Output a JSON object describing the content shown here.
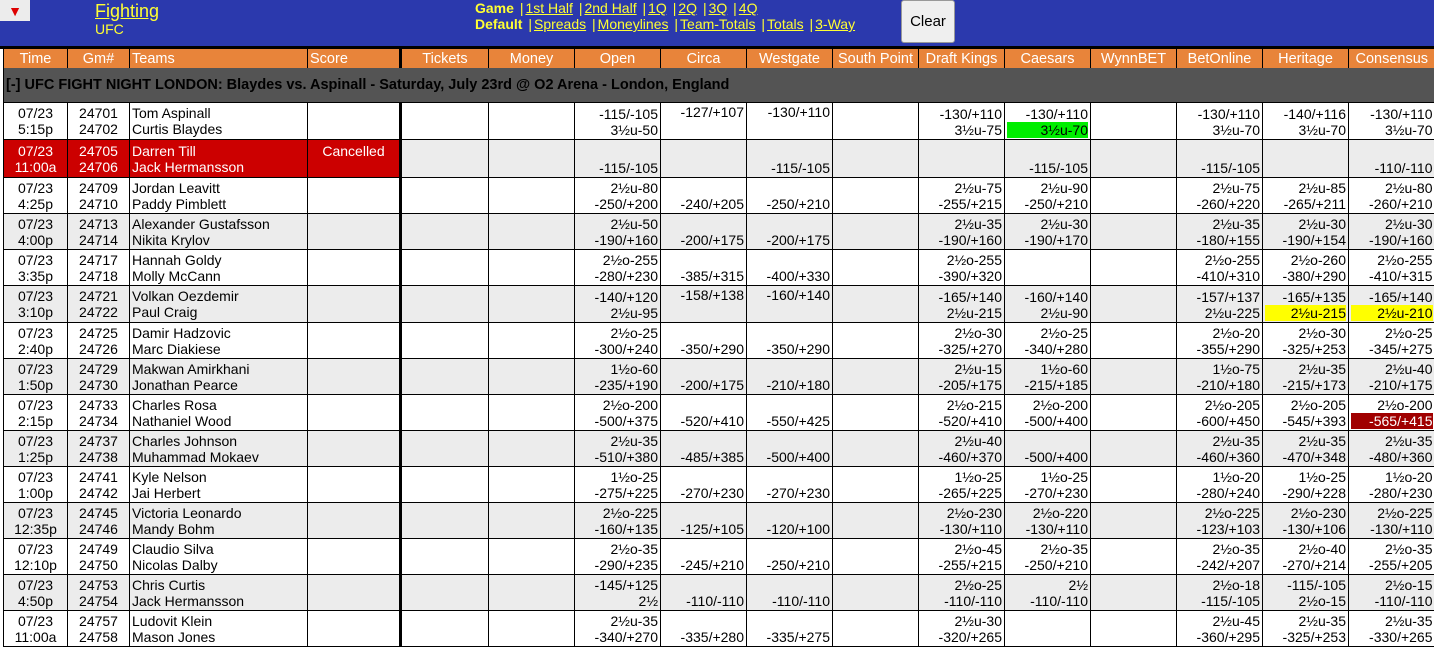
{
  "header": {
    "menu_icon": "▼",
    "sport_link": "Fighting",
    "league": "UFC",
    "periods_label": "Game",
    "periods": [
      "1st Half",
      "2nd Half",
      "1Q",
      "2Q",
      "3Q",
      "4Q"
    ],
    "markets_label": "Default",
    "markets": [
      "Spreads",
      "Moneylines",
      "Team-Totals",
      "Totals",
      "3-Way"
    ],
    "clear_label": "Clear"
  },
  "columns": [
    "Time",
    "Gm#",
    "Teams",
    "Score",
    "Tickets",
    "Money",
    "Open",
    "Circa",
    "Westgate",
    "South Point",
    "Draft Kings",
    "Caesars",
    "WynnBET",
    "BetOnline",
    "Heritage",
    "Consensus"
  ],
  "event_title": "[-]  UFC FIGHT NIGHT LONDON: Blaydes vs. Aspinall - Saturday, July 23rd @ O2 Arena - London, England",
  "highlight_colors": {
    "green": "#00ee00",
    "yellow": "#ffff00",
    "dark_red": "#a00000",
    "cancelled": "#cc0000"
  },
  "games": [
    {
      "date": "07/23",
      "time": "5:15p",
      "gm1": "24701",
      "gm2": "24702",
      "team1": "Tom Aspinall",
      "team2": "Curtis Blaydes",
      "score": "",
      "status": "",
      "open": [
        "-115/-105",
        "3½u-50"
      ],
      "circa": [
        "-127/+107",
        ""
      ],
      "westgate": [
        "-130/+110",
        ""
      ],
      "southpoint": [
        "",
        ""
      ],
      "draftkings": [
        "-130/+110",
        "3½u-75"
      ],
      "caesars": [
        "-130/+110",
        "3½u-70"
      ],
      "wynnbet": [
        "",
        ""
      ],
      "betonline": [
        "-130/+110",
        "3½u-70"
      ],
      "heritage": [
        "-140/+116",
        "3½u-70"
      ],
      "consensus": [
        "-130/+110",
        "3½u-70"
      ],
      "highlights": {
        "caesars.1": "green"
      }
    },
    {
      "date": "07/23",
      "time": "11:00a",
      "gm1": "24705",
      "gm2": "24706",
      "team1": "Darren Till",
      "team2": "Jack Hermansson",
      "score": "Cancelled",
      "status": "cancelled",
      "open": [
        "",
        "-115/-105"
      ],
      "circa": [
        "",
        ""
      ],
      "westgate": [
        "",
        "-115/-105"
      ],
      "southpoint": [
        "",
        ""
      ],
      "draftkings": [
        "",
        ""
      ],
      "caesars": [
        "",
        "-115/-105"
      ],
      "wynnbet": [
        "",
        ""
      ],
      "betonline": [
        "",
        "-115/-105"
      ],
      "heritage": [
        "",
        ""
      ],
      "consensus": [
        "",
        "-110/-110"
      ]
    },
    {
      "date": "07/23",
      "time": "4:25p",
      "gm1": "24709",
      "gm2": "24710",
      "team1": "Jordan Leavitt",
      "team2": "Paddy Pimblett",
      "score": "",
      "status": "",
      "open": [
        "2½u-80",
        "-250/+200"
      ],
      "circa": [
        "",
        "-240/+205"
      ],
      "westgate": [
        "",
        "-250/+210"
      ],
      "southpoint": [
        "",
        ""
      ],
      "draftkings": [
        "2½u-75",
        "-255/+215"
      ],
      "caesars": [
        "2½u-90",
        "-250/+210"
      ],
      "wynnbet": [
        "",
        ""
      ],
      "betonline": [
        "2½u-75",
        "-260/+220"
      ],
      "heritage": [
        "2½u-85",
        "-265/+211"
      ],
      "consensus": [
        "2½u-80",
        "-260/+210"
      ]
    },
    {
      "date": "07/23",
      "time": "4:00p",
      "gm1": "24713",
      "gm2": "24714",
      "team1": "Alexander Gustafsson",
      "team2": "Nikita Krylov",
      "score": "",
      "status": "",
      "open": [
        "2½u-50",
        "-190/+160"
      ],
      "circa": [
        "",
        "-200/+175"
      ],
      "westgate": [
        "",
        "-200/+175"
      ],
      "southpoint": [
        "",
        ""
      ],
      "draftkings": [
        "2½u-35",
        "-190/+160"
      ],
      "caesars": [
        "2½u-30",
        "-190/+170"
      ],
      "wynnbet": [
        "",
        ""
      ],
      "betonline": [
        "2½u-35",
        "-180/+155"
      ],
      "heritage": [
        "2½u-30",
        "-190/+154"
      ],
      "consensus": [
        "2½u-30",
        "-190/+160"
      ]
    },
    {
      "date": "07/23",
      "time": "3:35p",
      "gm1": "24717",
      "gm2": "24718",
      "team1": "Hannah Goldy",
      "team2": "Molly McCann",
      "score": "",
      "status": "",
      "open": [
        "2½o-255",
        "-280/+230"
      ],
      "circa": [
        "",
        "-385/+315"
      ],
      "westgate": [
        "",
        "-400/+330"
      ],
      "southpoint": [
        "",
        ""
      ],
      "draftkings": [
        "2½o-255",
        "-390/+320"
      ],
      "caesars": [
        "",
        ""
      ],
      "wynnbet": [
        "",
        ""
      ],
      "betonline": [
        "2½o-255",
        "-410/+310"
      ],
      "heritage": [
        "2½o-260",
        "-380/+290"
      ],
      "consensus": [
        "2½o-255",
        "-410/+315"
      ]
    },
    {
      "date": "07/23",
      "time": "3:10p",
      "gm1": "24721",
      "gm2": "24722",
      "team1": "Volkan Oezdemir",
      "team2": "Paul Craig",
      "score": "",
      "status": "",
      "open": [
        "-140/+120",
        "2½u-95"
      ],
      "circa": [
        "-158/+138",
        ""
      ],
      "westgate": [
        "-160/+140",
        ""
      ],
      "southpoint": [
        "",
        ""
      ],
      "draftkings": [
        "-165/+140",
        "2½u-215"
      ],
      "caesars": [
        "-160/+140",
        "2½u-90"
      ],
      "wynnbet": [
        "",
        ""
      ],
      "betonline": [
        "-157/+137",
        "2½u-225"
      ],
      "heritage": [
        "-165/+135",
        "2½u-215"
      ],
      "consensus": [
        "-165/+140",
        "2½u-210"
      ],
      "highlights": {
        "heritage.1": "yellow",
        "consensus.1": "yellow"
      }
    },
    {
      "date": "07/23",
      "time": "2:40p",
      "gm1": "24725",
      "gm2": "24726",
      "team1": "Damir Hadzovic",
      "team2": "Marc Diakiese",
      "score": "",
      "status": "",
      "open": [
        "2½o-25",
        "-300/+240"
      ],
      "circa": [
        "",
        "-350/+290"
      ],
      "westgate": [
        "",
        "-350/+290"
      ],
      "southpoint": [
        "",
        ""
      ],
      "draftkings": [
        "2½o-30",
        "-325/+270"
      ],
      "caesars": [
        "2½o-25",
        "-340/+280"
      ],
      "wynnbet": [
        "",
        ""
      ],
      "betonline": [
        "2½o-20",
        "-355/+290"
      ],
      "heritage": [
        "2½o-30",
        "-325/+253"
      ],
      "consensus": [
        "2½o-25",
        "-345/+275"
      ]
    },
    {
      "date": "07/23",
      "time": "1:50p",
      "gm1": "24729",
      "gm2": "24730",
      "team1": "Makwan Amirkhani",
      "team2": "Jonathan Pearce",
      "score": "",
      "status": "",
      "open": [
        "1½o-60",
        "-235/+190"
      ],
      "circa": [
        "",
        "-200/+175"
      ],
      "westgate": [
        "",
        "-210/+180"
      ],
      "southpoint": [
        "",
        ""
      ],
      "draftkings": [
        "2½u-15",
        "-205/+175"
      ],
      "caesars": [
        "1½o-60",
        "-215/+185"
      ],
      "wynnbet": [
        "",
        ""
      ],
      "betonline": [
        "1½o-75",
        "-210/+180"
      ],
      "heritage": [
        "2½u-35",
        "-215/+173"
      ],
      "consensus": [
        "2½u-40",
        "-210/+175"
      ]
    },
    {
      "date": "07/23",
      "time": "2:15p",
      "gm1": "24733",
      "gm2": "24734",
      "team1": "Charles Rosa",
      "team2": "Nathaniel Wood",
      "score": "",
      "status": "",
      "open": [
        "2½o-200",
        "-500/+375"
      ],
      "circa": [
        "",
        "-520/+410"
      ],
      "westgate": [
        "",
        "-550/+425"
      ],
      "southpoint": [
        "",
        ""
      ],
      "draftkings": [
        "2½o-215",
        "-520/+410"
      ],
      "caesars": [
        "2½o-200",
        "-500/+400"
      ],
      "wynnbet": [
        "",
        ""
      ],
      "betonline": [
        "2½o-205",
        "-600/+450"
      ],
      "heritage": [
        "2½o-205",
        "-545/+393"
      ],
      "consensus": [
        "2½o-200",
        "-565/+415"
      ],
      "highlights": {
        "consensus.1": "dark_red"
      }
    },
    {
      "date": "07/23",
      "time": "1:25p",
      "gm1": "24737",
      "gm2": "24738",
      "team1": "Charles Johnson",
      "team2": "Muhammad Mokaev",
      "score": "",
      "status": "",
      "open": [
        "2½u-35",
        "-510/+380"
      ],
      "circa": [
        "",
        "-485/+385"
      ],
      "westgate": [
        "",
        "-500/+400"
      ],
      "southpoint": [
        "",
        ""
      ],
      "draftkings": [
        "2½u-40",
        "-460/+370"
      ],
      "caesars": [
        "",
        "-500/+400"
      ],
      "wynnbet": [
        "",
        ""
      ],
      "betonline": [
        "2½u-35",
        "-460/+360"
      ],
      "heritage": [
        "2½u-35",
        "-470/+348"
      ],
      "consensus": [
        "2½u-35",
        "-480/+360"
      ]
    },
    {
      "date": "07/23",
      "time": "1:00p",
      "gm1": "24741",
      "gm2": "24742",
      "team1": "Kyle Nelson",
      "team2": "Jai Herbert",
      "score": "",
      "status": "",
      "open": [
        "1½o-25",
        "-275/+225"
      ],
      "circa": [
        "",
        "-270/+230"
      ],
      "westgate": [
        "",
        "-270/+230"
      ],
      "southpoint": [
        "",
        ""
      ],
      "draftkings": [
        "1½o-25",
        "-265/+225"
      ],
      "caesars": [
        "1½o-25",
        "-270/+230"
      ],
      "wynnbet": [
        "",
        ""
      ],
      "betonline": [
        "1½o-20",
        "-280/+240"
      ],
      "heritage": [
        "1½o-25",
        "-290/+228"
      ],
      "consensus": [
        "1½o-20",
        "-280/+230"
      ]
    },
    {
      "date": "07/23",
      "time": "12:35p",
      "gm1": "24745",
      "gm2": "24746",
      "team1": "Victoria Leonardo",
      "team2": "Mandy Bohm",
      "score": "",
      "status": "",
      "open": [
        "2½o-225",
        "-160/+135"
      ],
      "circa": [
        "",
        "-125/+105"
      ],
      "westgate": [
        "",
        "-120/+100"
      ],
      "southpoint": [
        "",
        ""
      ],
      "draftkings": [
        "2½o-230",
        "-130/+110"
      ],
      "caesars": [
        "2½o-220",
        "-130/+110"
      ],
      "wynnbet": [
        "",
        ""
      ],
      "betonline": [
        "2½o-225",
        "-123/+103"
      ],
      "heritage": [
        "2½o-230",
        "-130/+106"
      ],
      "consensus": [
        "2½o-225",
        "-130/+110"
      ]
    },
    {
      "date": "07/23",
      "time": "12:10p",
      "gm1": "24749",
      "gm2": "24750",
      "team1": "Claudio Silva",
      "team2": "Nicolas Dalby",
      "score": "",
      "status": "",
      "open": [
        "2½o-35",
        "-290/+235"
      ],
      "circa": [
        "",
        "-245/+210"
      ],
      "westgate": [
        "",
        "-250/+210"
      ],
      "southpoint": [
        "",
        ""
      ],
      "draftkings": [
        "2½o-45",
        "-255/+215"
      ],
      "caesars": [
        "2½o-35",
        "-250/+210"
      ],
      "wynnbet": [
        "",
        ""
      ],
      "betonline": [
        "2½o-35",
        "-242/+207"
      ],
      "heritage": [
        "2½o-40",
        "-270/+214"
      ],
      "consensus": [
        "2½o-35",
        "-255/+205"
      ]
    },
    {
      "date": "07/23",
      "time": "4:50p",
      "gm1": "24753",
      "gm2": "24754",
      "team1": "Chris Curtis",
      "team2": "Jack Hermansson",
      "score": "",
      "status": "",
      "open": [
        "-145/+125",
        "2½"
      ],
      "circa": [
        "",
        "-110/-110"
      ],
      "westgate": [
        "",
        "-110/-110"
      ],
      "southpoint": [
        "",
        ""
      ],
      "draftkings": [
        "2½o-25",
        "-110/-110"
      ],
      "caesars": [
        "2½",
        "-110/-110"
      ],
      "wynnbet": [
        "",
        ""
      ],
      "betonline": [
        "2½o-18",
        "-115/-105"
      ],
      "heritage": [
        "-115/-105",
        "2½o-15"
      ],
      "consensus": [
        "2½o-15",
        "-110/-110"
      ]
    },
    {
      "date": "07/23",
      "time": "11:00a",
      "gm1": "24757",
      "gm2": "24758",
      "team1": "Ludovit Klein",
      "team2": "Mason Jones",
      "score": "",
      "status": "",
      "open": [
        "2½u-35",
        "-340/+270"
      ],
      "circa": [
        "",
        "-335/+280"
      ],
      "westgate": [
        "",
        "-335/+275"
      ],
      "southpoint": [
        "",
        ""
      ],
      "draftkings": [
        "2½u-30",
        "-320/+265"
      ],
      "caesars": [
        "",
        ""
      ],
      "wynnbet": [
        "",
        ""
      ],
      "betonline": [
        "2½u-45",
        "-360/+295"
      ],
      "heritage": [
        "2½u-35",
        "-325/+253"
      ],
      "consensus": [
        "2½u-35",
        "-330/+265"
      ]
    }
  ]
}
